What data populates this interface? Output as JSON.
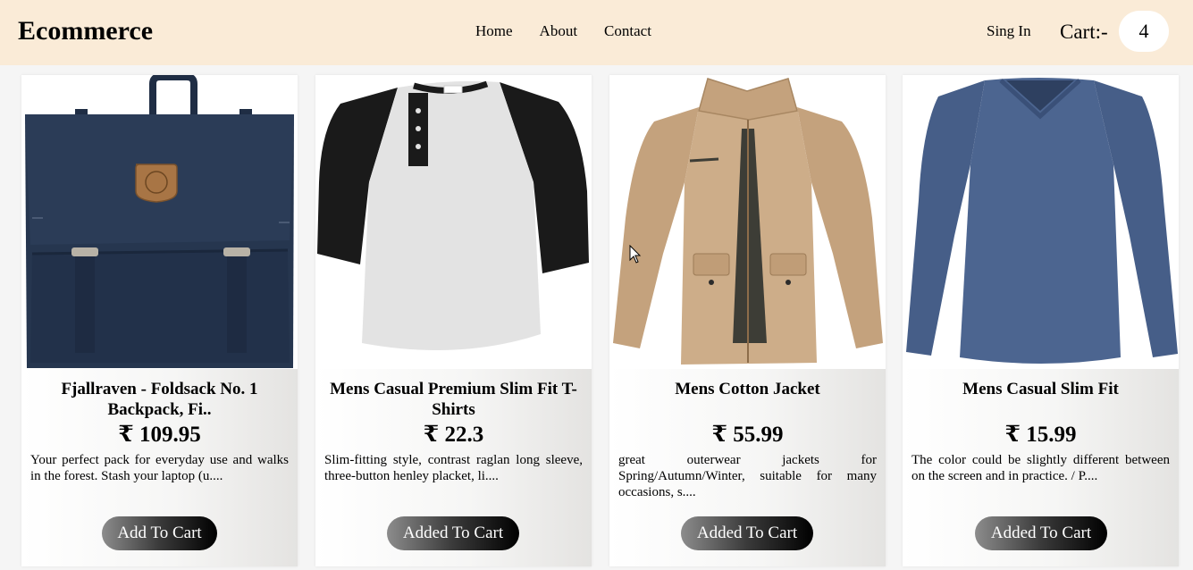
{
  "header": {
    "brand": "Ecommerce",
    "nav": {
      "home": "Home",
      "about": "About",
      "contact": "Contact"
    },
    "signin": "Sing In",
    "cart_label": "Cart:-",
    "cart_count": "4"
  },
  "products": [
    {
      "title": "Fjallraven - Foldsack No. 1 Backpack, Fi..",
      "price": "₹ 109.95",
      "description": "Your perfect pack for everyday use and walks in the forest. Stash your laptop (u....",
      "button": "Add To Cart",
      "image_icon": "backpack-image"
    },
    {
      "title": "Mens Casual Premium Slim Fit T-Shirts",
      "price": "₹ 22.3",
      "description": "Slim-fitting style, contrast raglan long sleeve, three-button henley placket, li....",
      "button": "Added To Cart",
      "image_icon": "raglan-shirt-image"
    },
    {
      "title": "Mens Cotton Jacket",
      "price": "₹ 55.99",
      "description": "great outerwear jackets for Spring/Autumn/Winter, suitable for many occasions, s....",
      "button": "Added To Cart",
      "image_icon": "jacket-image"
    },
    {
      "title": "Mens Casual Slim Fit",
      "price": "₹ 15.99",
      "description": "The color could be slightly different between on the screen and in practice. / P....",
      "button": "Added To Cart",
      "image_icon": "long-sleeve-shirt-image"
    }
  ],
  "colors": {
    "navbar_bg": "#faebd7",
    "backpack": "#26364f",
    "shirt_body": "#e3e3e3",
    "shirt_sleeve": "#1a1a1a",
    "jacket": "#c9a985",
    "longsleeve": "#4c6590"
  }
}
